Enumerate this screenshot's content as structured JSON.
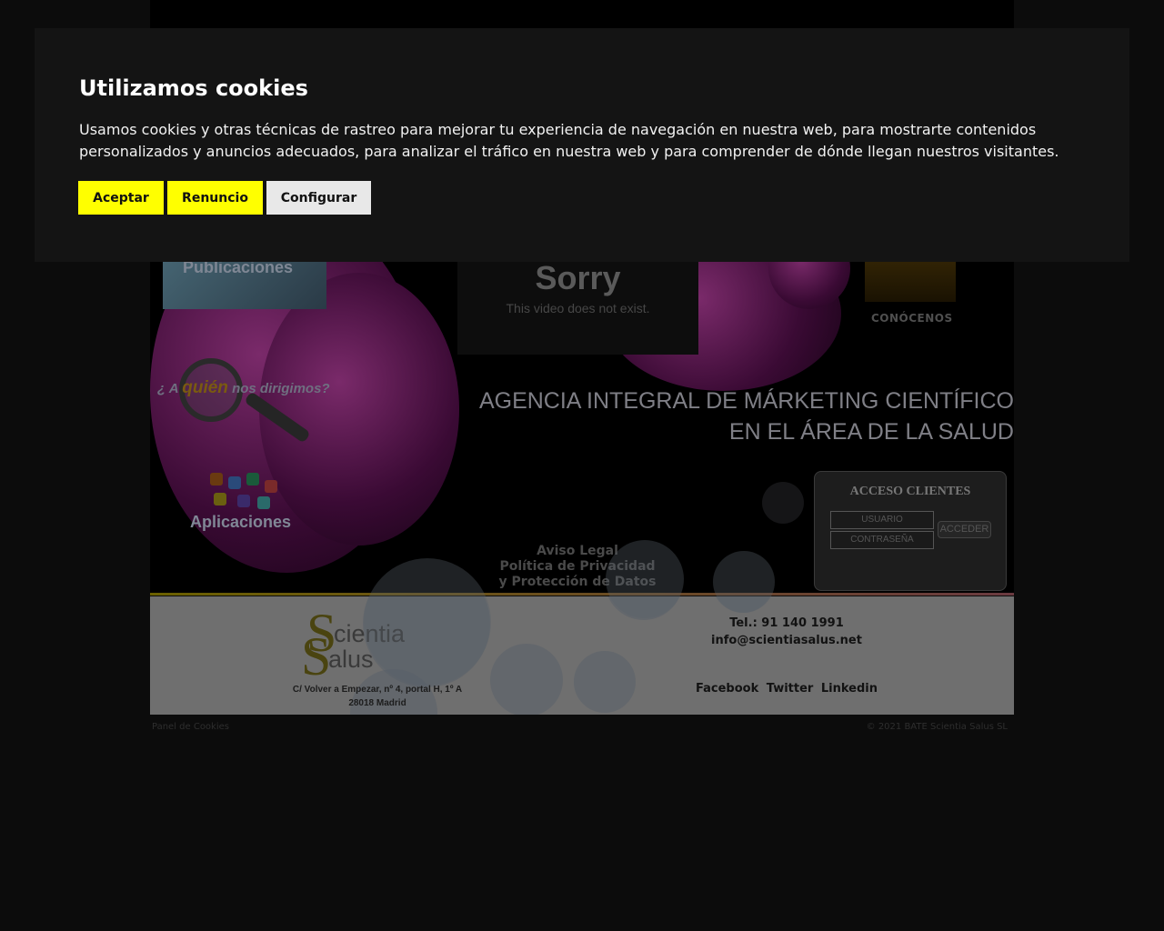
{
  "cookie_banner": {
    "title": "Utilizamos cookies",
    "text": "Usamos cookies y otras técnicas de rastreo para mejorar tu experiencia de navegación en nuestra web, para mostrarte contenidos personalizados y anuncios adecuados, para analizar el tráfico en nuestra web y para comprender de dónde llegan nuestros visitantes.",
    "accept_label": "Aceptar",
    "reject_label": "Renuncio",
    "configure_label": "Configurar",
    "accent_color": "#ffff00"
  },
  "hero": {
    "publicaciones_label": "Publicaciones",
    "quien_prefix": "¿ A",
    "quien_highlight": "quién",
    "quien_suffix": "nos dirigimos?",
    "aplicaciones_label": "Aplicaciones",
    "video_title": "Sorry",
    "video_message": "This video does not exist.",
    "conocenos_label": "CONÓCENOS",
    "tagline_line1": "AGENCIA INTEGRAL DE MÁRKETING CIENTÍFICO",
    "tagline_line2": "EN EL ÁREA DE LA SALUD",
    "legal": {
      "aviso": "Aviso Legal",
      "privacidad_line1": "Política de Privacidad",
      "privacidad_line2": "y Protección de Datos"
    }
  },
  "client_access": {
    "title": "ACCESO CLIENTES",
    "user_placeholder": "USUARIO",
    "password_placeholder": "CONTRASEÑA",
    "submit_label": "ACCEDER"
  },
  "footer": {
    "logo_text_top": "cientia",
    "logo_text_bottom": "alus",
    "address_line1": "C/ Volver a Empezar, nº 4, portal H, 1º A",
    "address_line2": "28018 Madrid",
    "phone": "Tel.: 91 140 1991",
    "email": "info@scientiasalus.net",
    "social": [
      "Facebook",
      "Twitter",
      "Linkedin"
    ]
  },
  "bottom_bar": {
    "cookies_panel": "Panel de Cookies",
    "copyright": "© 2021 BATE Scientia Salus SL"
  }
}
